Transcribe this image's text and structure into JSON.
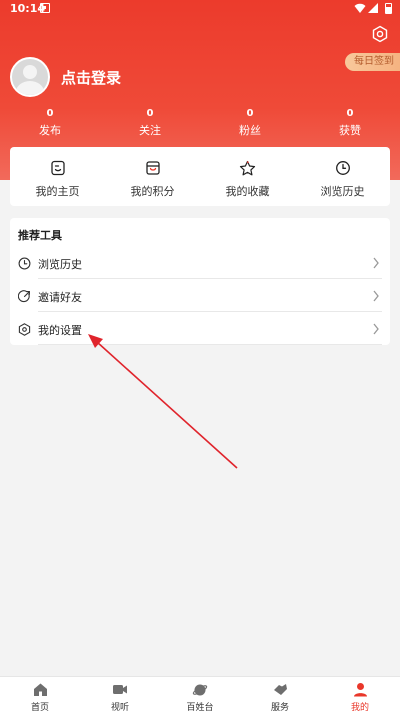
{
  "status_bar": {
    "time": "10:14"
  },
  "header": {
    "checkin_label": "每日签到",
    "login_label": "点击登录",
    "stats": [
      {
        "value": "0",
        "label": "发布"
      },
      {
        "value": "0",
        "label": "关注"
      },
      {
        "value": "0",
        "label": "粉丝"
      },
      {
        "value": "0",
        "label": "获赞"
      }
    ]
  },
  "quick_links": [
    {
      "label": "我的主页",
      "icon": "homepage-icon"
    },
    {
      "label": "我的积分",
      "icon": "points-bag-icon"
    },
    {
      "label": "我的收藏",
      "icon": "star-icon"
    },
    {
      "label": "浏览历史",
      "icon": "clock-icon"
    }
  ],
  "tools": {
    "title": "推荐工具",
    "items": [
      {
        "label": "浏览历史",
        "icon": "clock-icon"
      },
      {
        "label": "邀请好友",
        "icon": "invite-icon"
      },
      {
        "label": "我的设置",
        "icon": "settings-hex-icon"
      }
    ]
  },
  "tab_bar": {
    "active_index": 4,
    "accent_color": "#e9372a",
    "tabs": [
      {
        "label": "首页",
        "icon": "home-icon"
      },
      {
        "label": "视听",
        "icon": "video-icon"
      },
      {
        "label": "百姓台",
        "icon": "planet-icon"
      },
      {
        "label": "服务",
        "icon": "service-icon"
      },
      {
        "label": "我的",
        "icon": "user-icon"
      }
    ]
  },
  "annotation": {
    "arrow_color": "#e0242c"
  }
}
